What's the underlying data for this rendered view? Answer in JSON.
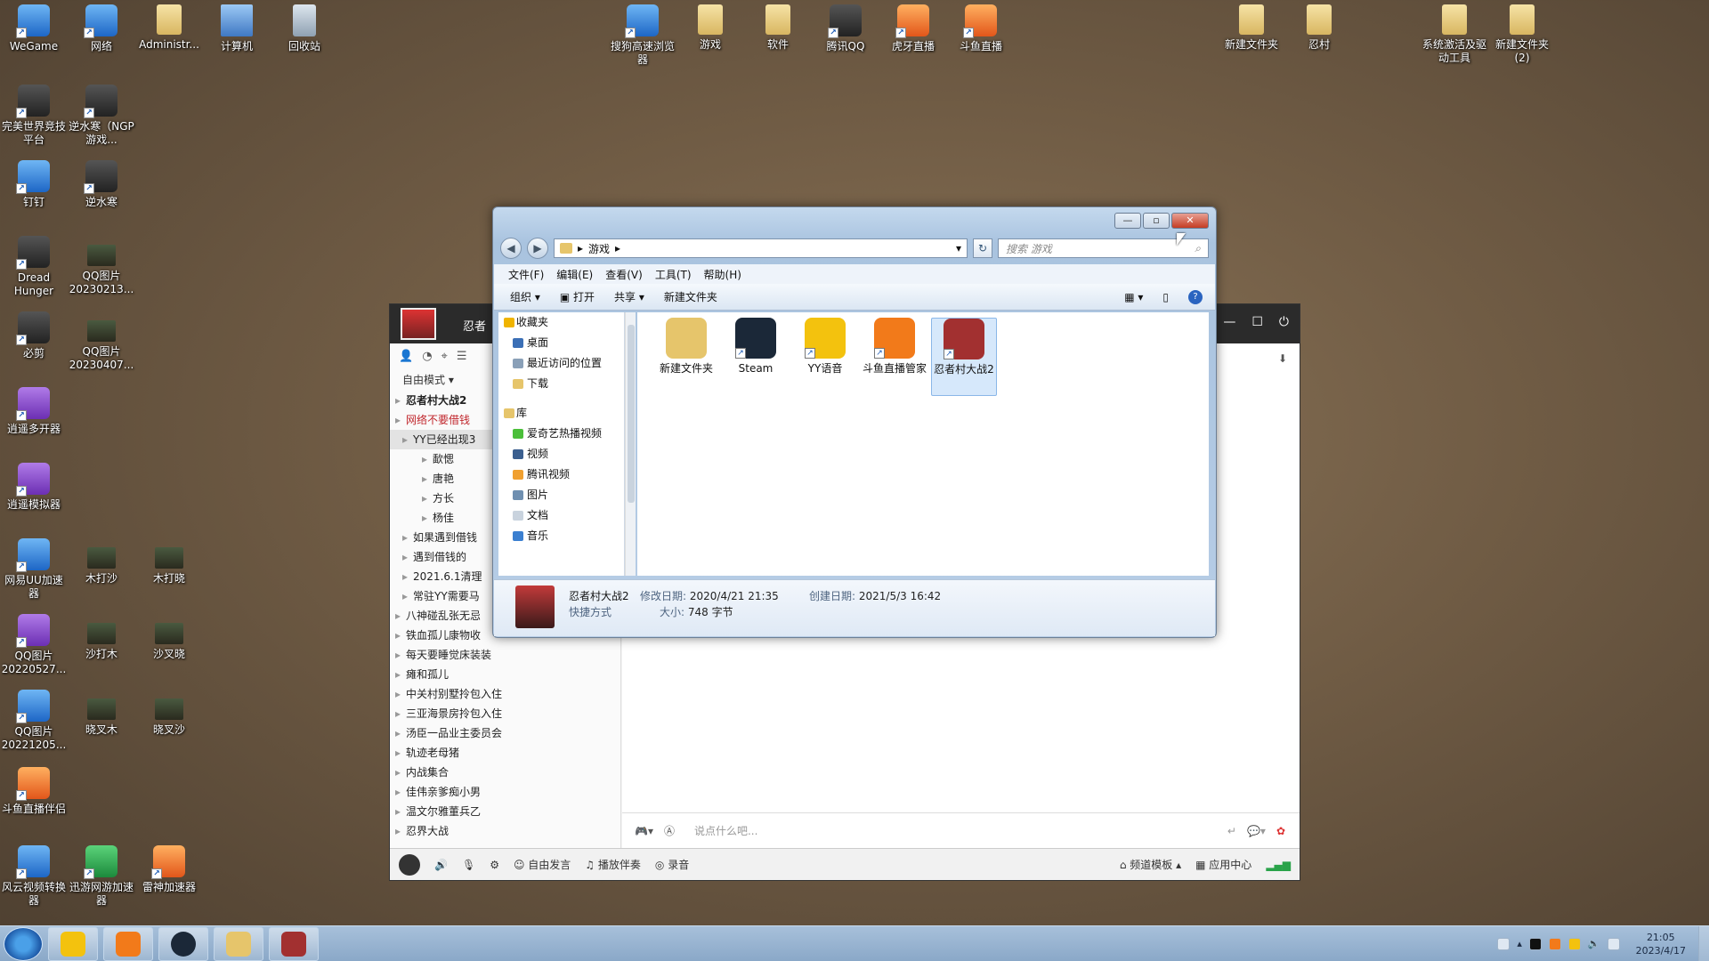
{
  "desktop_icons": [
    {
      "label": "WeGame"
    },
    {
      "label": "网络"
    },
    {
      "label": "Administr..."
    },
    {
      "label": "计算机"
    },
    {
      "label": "回收站"
    },
    {
      "label": "完美世界竞技平台"
    },
    {
      "label": "逆水寒（NGP游戏..."
    },
    {
      "label": "钉钉"
    },
    {
      "label": "逆水寒"
    },
    {
      "label": "Dread Hunger"
    },
    {
      "label": "QQ图片20230213..."
    },
    {
      "label": "必剪"
    },
    {
      "label": "QQ图片20230407..."
    },
    {
      "label": "逍遥多开器"
    },
    {
      "label": "逍遥模拟器"
    },
    {
      "label": "网易UU加速器"
    },
    {
      "label": "木打沙"
    },
    {
      "label": "木打晓"
    },
    {
      "label": "QQ图片20220527..."
    },
    {
      "label": "沙打木"
    },
    {
      "label": "沙叉晓"
    },
    {
      "label": "QQ图片20221205..."
    },
    {
      "label": "晓叉木"
    },
    {
      "label": "晓叉沙"
    },
    {
      "label": "斗鱼直播伴侣"
    },
    {
      "label": "风云视频转换器"
    },
    {
      "label": "迅游网游加速器"
    },
    {
      "label": "雷神加速器"
    },
    {
      "label": "搜狗高速浏览器"
    },
    {
      "label": "游戏"
    },
    {
      "label": "软件"
    },
    {
      "label": "腾讯QQ"
    },
    {
      "label": "虎牙直播"
    },
    {
      "label": "斗鱼直播"
    },
    {
      "label": "新建文件夹"
    },
    {
      "label": "忍村"
    },
    {
      "label": "系统激活及驱动工具"
    },
    {
      "label": "新建文件夹 (2)"
    }
  ],
  "yy": {
    "title": "忍者",
    "mode": "自由模式",
    "tree": [
      "忍者村大战2",
      "网络不要借钱",
      "YY已经出现3",
      "歃愢",
      "唐艳",
      "方长",
      "杨佳",
      "如果遇到借钱",
      "遇到借钱的",
      "2021.6.1清理",
      "常驻YY需要马",
      "八神碰乱张无忌",
      "铁血孤儿康物收",
      "每天要睡觉床装装",
      "瘫和孤儿",
      "中关村别墅拎包入住",
      "三亚海景房拎包入住",
      "汤臣一品业主委员会",
      "轨迹老母猪",
      "内战集合",
      "佳伟亲爹痴小男",
      "温文尔雅董兵乙",
      "忍界大战"
    ],
    "input_placeholder": "说点什么吧...",
    "bottom": {
      "free_speak": "自由发言",
      "play_music": "播放伴奏",
      "record": "录音",
      "channel_template": "频道模板",
      "app_center": "应用中心"
    }
  },
  "explorer": {
    "breadcrumb": "游戏",
    "search_placeholder": "搜索 游戏",
    "menu": [
      "文件(F)",
      "编辑(E)",
      "查看(V)",
      "工具(T)",
      "帮助(H)"
    ],
    "commands": {
      "organize": "组织 ▾",
      "open": "打开",
      "share": "共享 ▾",
      "new_folder": "新建文件夹"
    },
    "nav": [
      {
        "label": "收藏夹",
        "header": true,
        "color": "#f0b400"
      },
      {
        "label": "桌面",
        "color": "#3b6fb6"
      },
      {
        "label": "最近访问的位置",
        "color": "#8aa0b8"
      },
      {
        "label": "下载",
        "color": "#e6c56b"
      },
      {
        "label": "库",
        "header": true,
        "color": "#e6c56b"
      },
      {
        "label": "爱奇艺热播视频",
        "color": "#4bbf3a"
      },
      {
        "label": "视频",
        "color": "#3b5f8f"
      },
      {
        "label": "腾讯视频",
        "color": "#f0a030"
      },
      {
        "label": "图片",
        "color": "#6f8fb0"
      },
      {
        "label": "文档",
        "color": "#c9d3de"
      },
      {
        "label": "音乐",
        "color": "#3b7fd0"
      }
    ],
    "files": [
      {
        "label": "新建文件夹",
        "color": "#e6c56b",
        "shortcut": false,
        "selected": false
      },
      {
        "label": "Steam",
        "color": "#1b2838",
        "shortcut": true,
        "selected": false
      },
      {
        "label": "YY语音",
        "color": "#f3c20e",
        "shortcut": true,
        "selected": false
      },
      {
        "label": "斗鱼直播管家",
        "color": "#f27a1a",
        "shortcut": true,
        "selected": false
      },
      {
        "label": "忍者村大战2",
        "color": "#a23030",
        "shortcut": true,
        "selected": true
      }
    ],
    "details": {
      "name": "忍者村大战2",
      "type": "快捷方式",
      "modified_label": "修改日期:",
      "modified": "2020/4/21 21:35",
      "size_label": "大小:",
      "size": "748 字节",
      "created_label": "创建日期:",
      "created": "2021/5/3 16:42"
    }
  },
  "taskbar": {
    "time": "21:05",
    "date": "2023/4/17"
  }
}
